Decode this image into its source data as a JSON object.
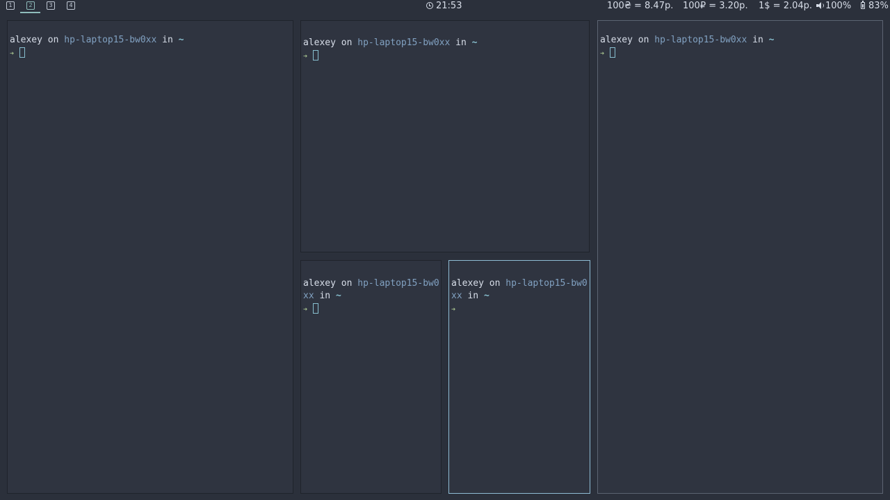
{
  "bar": {
    "workspaces": [
      {
        "label": "1",
        "active": false
      },
      {
        "label": "2",
        "active": true
      },
      {
        "label": "3",
        "active": false
      },
      {
        "label": "4",
        "active": false
      }
    ],
    "clock": "21:53",
    "rates": {
      "uah": "100₴ = 8.47р.",
      "rub": "100₽ = 3.20р.",
      "usd": "1$ = 2.04р."
    },
    "volume": "100%",
    "battery": "83%"
  },
  "terminals": [
    {
      "user": "alexey",
      "on": "on",
      "host": "hp-laptop15-bw0xx",
      "in": "in",
      "dir": "~",
      "arrow": "➜"
    },
    {
      "user": "alexey",
      "on": "on",
      "host": "hp-laptop15-bw0xx",
      "in": "in",
      "dir": "~",
      "arrow": "➜"
    },
    {
      "user": "alexey",
      "on": "on",
      "host": "hp-laptop15-bw0xx",
      "in": "in",
      "dir": "~",
      "arrow": "➜"
    },
    {
      "user": "alexey",
      "on": "on",
      "host": "hp-laptop15-bw0xx",
      "in": "in",
      "dir": "~",
      "arrow": "➜"
    },
    {
      "user": "alexey",
      "on": "on",
      "host": "hp-laptop15-bw0xx",
      "in": "in",
      "dir": "~",
      "arrow": "➜"
    }
  ],
  "colors": {
    "background": "#2b303b",
    "terminal_bg": "#2f3440",
    "focus_border": "#8fbcd4",
    "host": "#81a1c1",
    "arrow": "#a3be8c"
  }
}
